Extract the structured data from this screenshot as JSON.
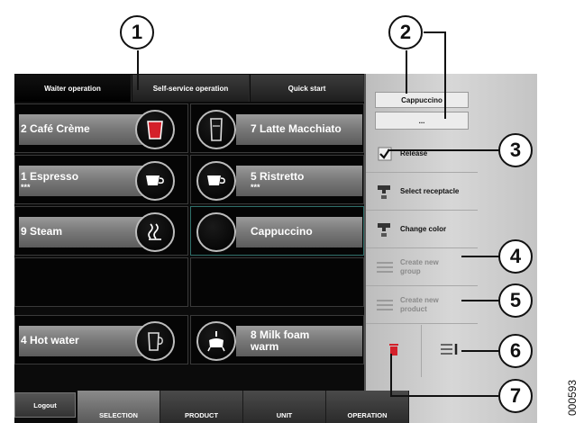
{
  "tabs": [
    {
      "label": "Waiter operation",
      "active": true
    },
    {
      "label": "Self-service operation",
      "active": false
    },
    {
      "label": "Quick start",
      "active": false
    }
  ],
  "products": [
    {
      "name": "2 Café Crème",
      "icon": "red-cup-icon"
    },
    {
      "name": "7 Latte Macchiato",
      "icon": "tall-glass-icon"
    },
    {
      "name": "1 Espresso",
      "sub": "***",
      "icon": "espresso-cup-icon"
    },
    {
      "name": "5 Ristretto",
      "sub": "***",
      "icon": "espresso-cup-icon"
    },
    {
      "name": "9 Steam",
      "icon": "steam-icon"
    },
    {
      "name": "Cappuccino",
      "icon": "empty-circle",
      "selected": true
    },
    {
      "name": "4 Hot water",
      "icon": "hot-water-glass-icon"
    },
    {
      "name": "8 Milk foam warm",
      "line1": "8 Milk foam",
      "line2": "warm",
      "icon": "milk-jug-icon"
    }
  ],
  "panel": {
    "name_field": "Cappuccino",
    "second_field": "...",
    "release_label": "Release",
    "select_receptacle_label": "Select receptacle",
    "change_color_label": "Change color",
    "create_group_line1": "Create new",
    "create_group_line2": "group",
    "create_product_line1": "Create new",
    "create_product_line2": "product"
  },
  "bottom_nav": {
    "logout": "Logout",
    "items": [
      {
        "label": "SELECTION",
        "selected": true
      },
      {
        "label": "PRODUCT",
        "selected": false
      },
      {
        "label": "UNIT",
        "selected": false
      },
      {
        "label": "OPERATION",
        "selected": false
      }
    ]
  },
  "callouts": [
    "1",
    "2",
    "3",
    "4",
    "5",
    "6",
    "7"
  ],
  "figure_code": "000593",
  "colors": {
    "accent_red": "#d4202a",
    "selected_border": "#2f6f6a"
  }
}
